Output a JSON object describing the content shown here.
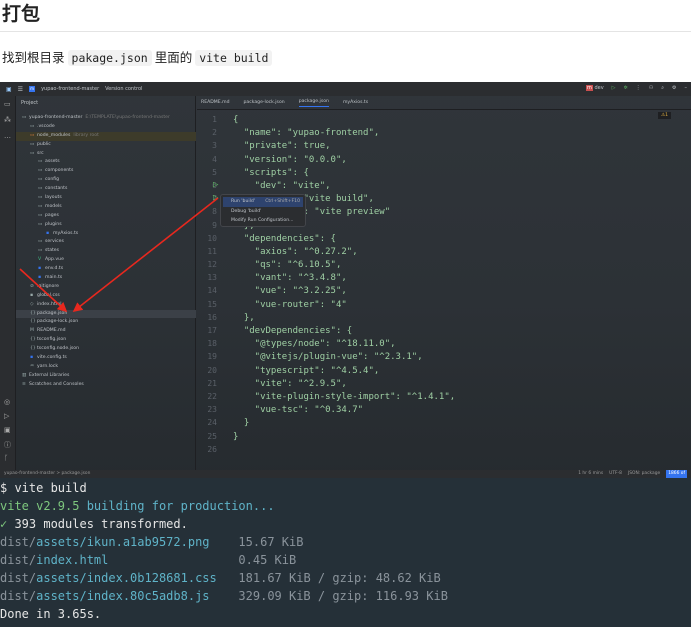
{
  "doc": {
    "title": "打包",
    "text_before": "找到根目录",
    "code1": "pakage.json",
    "text_mid": "里面的",
    "code2": "vite build"
  },
  "ide": {
    "project": "yupao-frontend-master",
    "vcs": "Version control",
    "run_config": "dev",
    "panel_title": "Project",
    "tree": [
      {
        "label": "yupao-frontend-master",
        "extra": "E:\\TEMPLATE\\yupao-frontend-master",
        "depth": 0,
        "icon": "folder"
      },
      {
        "label": ".vscode",
        "depth": 1,
        "icon": "folder"
      },
      {
        "label": "node_modules",
        "extra": "library root",
        "depth": 1,
        "icon": "folder",
        "hl": true
      },
      {
        "label": "public",
        "depth": 1,
        "icon": "folder"
      },
      {
        "label": "src",
        "depth": 1,
        "icon": "folder"
      },
      {
        "label": "assets",
        "depth": 2,
        "icon": "folder"
      },
      {
        "label": "components",
        "depth": 2,
        "icon": "folder"
      },
      {
        "label": "config",
        "depth": 2,
        "icon": "folder"
      },
      {
        "label": "constants",
        "depth": 2,
        "icon": "folder"
      },
      {
        "label": "layouts",
        "depth": 2,
        "icon": "folder"
      },
      {
        "label": "models",
        "depth": 2,
        "icon": "folder"
      },
      {
        "label": "pages",
        "depth": 2,
        "icon": "folder"
      },
      {
        "label": "plugins",
        "depth": 2,
        "icon": "folder"
      },
      {
        "label": "myAxios.ts",
        "depth": 3,
        "icon": "ts"
      },
      {
        "label": "services",
        "depth": 2,
        "icon": "folder"
      },
      {
        "label": "states",
        "depth": 2,
        "icon": "folder"
      },
      {
        "label": "App.vue",
        "depth": 2,
        "icon": "vue"
      },
      {
        "label": "env.d.ts",
        "depth": 2,
        "icon": "ts"
      },
      {
        "label": "main.ts",
        "depth": 2,
        "icon": "ts"
      },
      {
        "label": ".gitignore",
        "depth": 1,
        "icon": "file"
      },
      {
        "label": "global.css",
        "depth": 1,
        "icon": "css"
      },
      {
        "label": "index.html",
        "depth": 1,
        "icon": "html"
      },
      {
        "label": "package.json",
        "depth": 1,
        "icon": "json",
        "selected": true
      },
      {
        "label": "package-lock.json",
        "depth": 1,
        "icon": "json"
      },
      {
        "label": "README.md",
        "depth": 1,
        "icon": "md"
      },
      {
        "label": "tsconfig.json",
        "depth": 1,
        "icon": "json"
      },
      {
        "label": "tsconfig.node.json",
        "depth": 1,
        "icon": "json"
      },
      {
        "label": "vite.config.ts",
        "depth": 1,
        "icon": "ts"
      },
      {
        "label": "yarn.lock",
        "depth": 1,
        "icon": "yarn"
      },
      {
        "label": "External Libraries",
        "depth": 0,
        "icon": "library"
      },
      {
        "label": "Scratches and Consoles",
        "depth": 0,
        "icon": "scratch"
      }
    ],
    "tabs": [
      {
        "label": "README.md"
      },
      {
        "label": "package-lock.json"
      },
      {
        "label": "package.json",
        "active": true
      },
      {
        "label": "myAxios.ts"
      }
    ],
    "code": [
      "{",
      "  \"name\": \"yupao-frontend\",",
      "  \"private\": true,",
      "  \"version\": \"0.0.0\",",
      "  \"scripts\": {",
      "    \"dev\": \"vite\",",
      "    \"build\": \"vite build\",",
      "    \"preview\": \"vite preview\"",
      "  },",
      "  \"dependencies\": {",
      "    \"axios\": \"^0.27.2\",",
      "    \"qs\": \"^6.10.5\",",
      "    \"vant\": \"^3.4.8\",",
      "    \"vue\": \"^3.2.25\",",
      "    \"vue-router\": \"4\"",
      "  },",
      "  \"devDependencies\": {",
      "    \"@types/node\": \"^18.11.0\",",
      "    \"@vitejs/plugin-vue\": \"^2.3.1\",",
      "    \"typescript\": \"^4.5.4\",",
      "    \"vite\": \"^2.9.5\",",
      "    \"vite-plugin-style-import\": \"^1.4.1\",",
      "    \"vue-tsc\": \"^0.34.7\"",
      "  }",
      "}",
      ""
    ],
    "context_menu": [
      {
        "label": "Run 'build'",
        "shortcut": "Ctrl+Shift+F10"
      },
      {
        "label": "Debug 'build'"
      },
      {
        "label": "Modify Run Configuration..."
      }
    ],
    "inspections": "1",
    "status": {
      "breadcrumb": "yupao-frontend-master  >  package.json",
      "time": "1 hr 6 mins",
      "encoding": "UTF-8",
      "schema": "JSON: package",
      "memory": "1866 of"
    }
  },
  "terminal": [
    {
      "parts": [
        {
          "t": "$ vite build",
          "c": "w"
        }
      ]
    },
    {
      "parts": [
        {
          "t": "vite v2.9.5 ",
          "c": "g"
        },
        {
          "t": "building for production...",
          "c": "c"
        }
      ]
    },
    {
      "parts": [
        {
          "t": "✓ ",
          "c": "g"
        },
        {
          "t": "393 modules transformed.",
          "c": "w"
        }
      ]
    },
    {
      "parts": [
        {
          "t": "dist/",
          "c": "d"
        },
        {
          "t": "assets/ikun.a1ab9572.png",
          "c": "c"
        },
        {
          "t": "    15.67 KiB",
          "c": "d"
        }
      ]
    },
    {
      "parts": [
        {
          "t": "dist/",
          "c": "d"
        },
        {
          "t": "index.html",
          "c": "c"
        },
        {
          "t": "                  0.45 KiB",
          "c": "d"
        }
      ]
    },
    {
      "parts": [
        {
          "t": "dist/",
          "c": "d"
        },
        {
          "t": "assets/index.0b128681.css",
          "c": "c"
        },
        {
          "t": "   181.67 KiB / gzip: 48.62 KiB",
          "c": "d"
        }
      ]
    },
    {
      "parts": [
        {
          "t": "dist/",
          "c": "d"
        },
        {
          "t": "assets/index.80c5adb8.js",
          "c": "c"
        },
        {
          "t": "    329.09 KiB / gzip: 116.93 KiB",
          "c": "d"
        }
      ]
    },
    {
      "parts": [
        {
          "t": "Done in 3.65s.",
          "c": "w"
        }
      ]
    }
  ]
}
